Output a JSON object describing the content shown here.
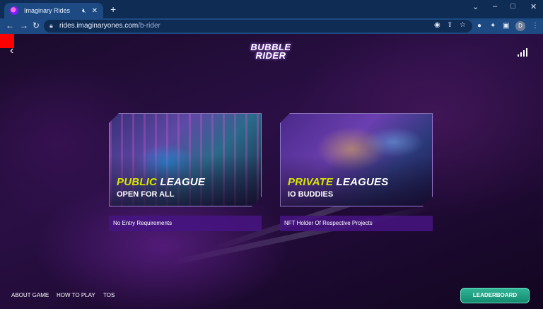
{
  "browser": {
    "tab": {
      "title": "Imaginary Rides"
    },
    "new_tab_symbol": "+",
    "address": {
      "domain": "rides.imaginaryones.com",
      "path": "/b-rider"
    },
    "profile_initial": "D"
  },
  "page": {
    "logo": {
      "line1": "BUBBLE",
      "line2": "RIDER"
    },
    "cards": [
      {
        "title_accent": "PUBLIC",
        "title_rest": " LEAGUE",
        "subtitle": "OPEN FOR ALL",
        "requirement": "No Entry Requirements"
      },
      {
        "title_accent": "PRIVATE",
        "title_rest": " LEAGUES",
        "subtitle": "IO BUDDIES",
        "requirement": "NFT Holder Of Respective Projects"
      }
    ],
    "footer": {
      "about": "ABOUT GAME",
      "how_to": "HOW TO PLAY",
      "tos": "TOS"
    },
    "leaderboard_label": "LEADERBOARD"
  },
  "icons": [
    "favicon",
    "mute-icon",
    "close-icon",
    "back-arrow-icon",
    "forward-arrow-icon",
    "reload-icon",
    "lock-icon",
    "share-icon",
    "star-icon",
    "extensions-icon",
    "sidepanel-icon",
    "more-icon",
    "signal-icon"
  ],
  "colors": {
    "accent_yellow": "#d8e600",
    "leaderboard_green": "#1fa283",
    "requirement_bg": "#46148a",
    "browser_chrome": "#1d4a82"
  }
}
